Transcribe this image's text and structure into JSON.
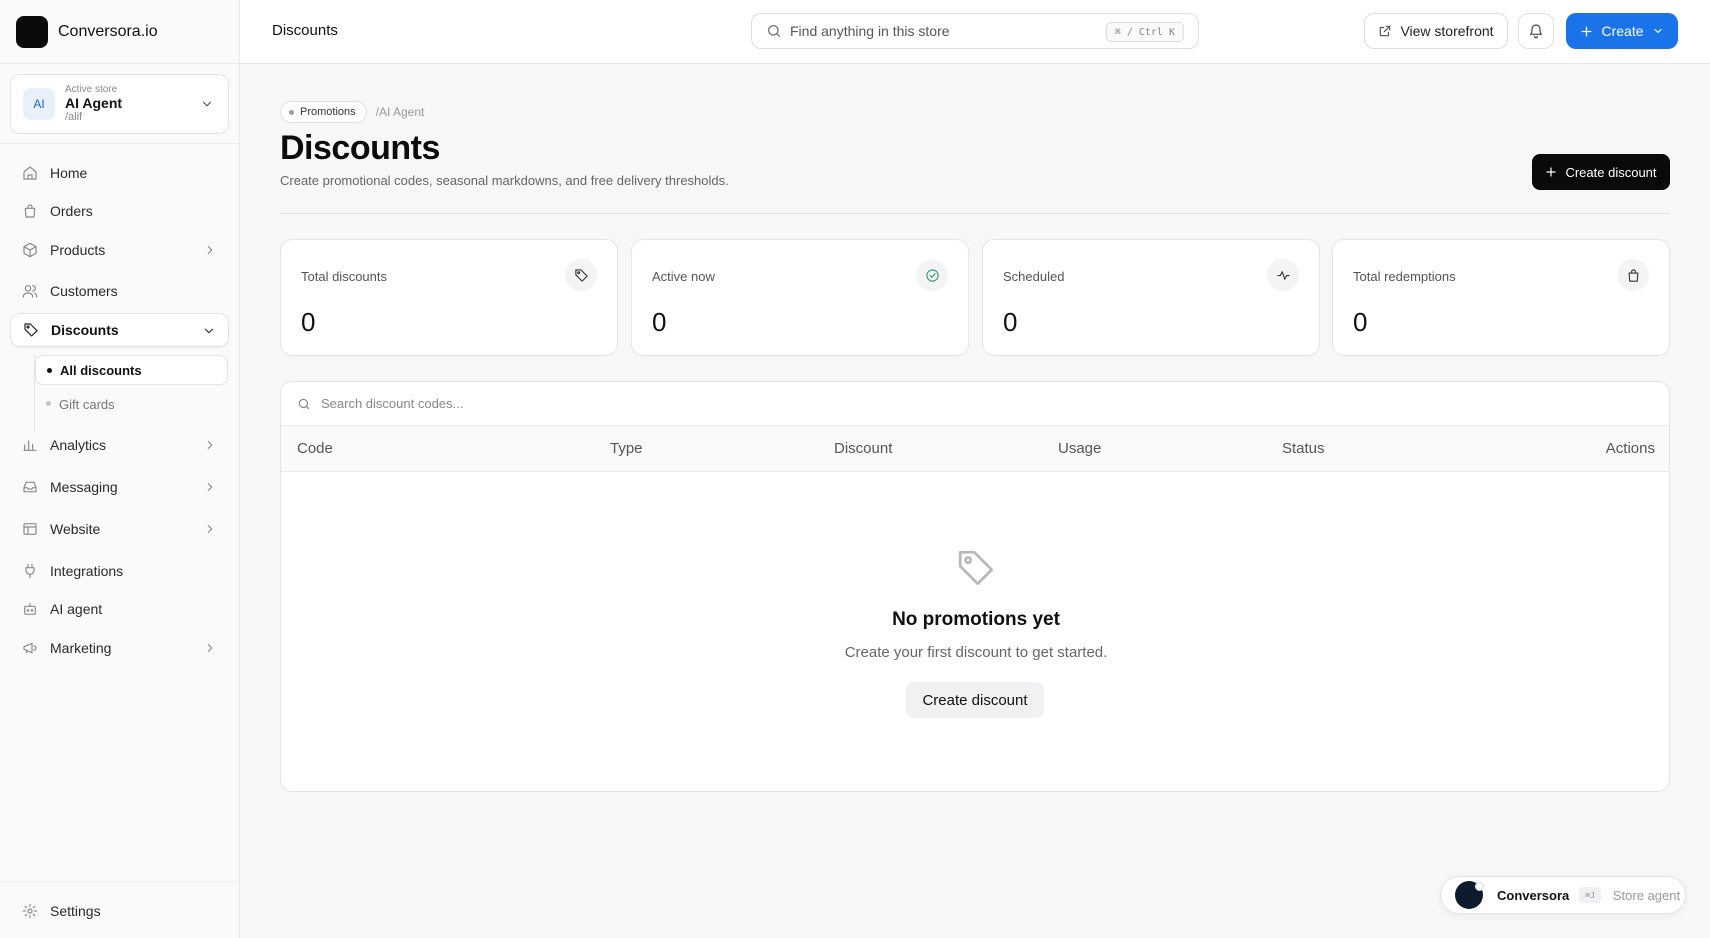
{
  "brand": {
    "name": "Conversora.io"
  },
  "store": {
    "kicker": "Active store",
    "avatar": "AI",
    "name": "AI Agent",
    "handle": "/alif"
  },
  "nav": {
    "home": "Home",
    "orders": "Orders",
    "products": "Products",
    "customers": "Customers",
    "discounts": "Discounts",
    "sub_all": "All discounts",
    "sub_gift": "Gift cards",
    "analytics": "Analytics",
    "messaging": "Messaging",
    "website": "Website",
    "integrations": "Integrations",
    "ai_agent": "AI agent",
    "marketing": "Marketing",
    "settings": "Settings"
  },
  "topbar": {
    "title": "Discounts",
    "search_placeholder": "Find anything in this store",
    "shortcut": "⌘ / Ctrl K",
    "storefront": "View storefront",
    "create": "Create"
  },
  "page": {
    "crumb": "Promotions",
    "crumb_rest": "/AI Agent",
    "title": "Discounts",
    "subtitle": "Create promotional codes, seasonal markdowns, and free delivery thresholds.",
    "create_button": "Create discount"
  },
  "stats": [
    {
      "label": "Total discounts",
      "value": "0",
      "icon": "tag-icon"
    },
    {
      "label": "Active now",
      "value": "0",
      "icon": "check-circle-icon"
    },
    {
      "label": "Scheduled",
      "value": "0",
      "icon": "activity-icon"
    },
    {
      "label": "Total redemptions",
      "value": "0",
      "icon": "shopping-bag-icon"
    }
  ],
  "table": {
    "search_placeholder": "Search discount codes...",
    "columns": [
      "Code",
      "Type",
      "Discount",
      "Usage",
      "Status",
      "Actions"
    ],
    "empty_title": "No promotions yet",
    "empty_sub": "Create your first discount to get started.",
    "empty_button": "Create discount"
  },
  "agent": {
    "name": "Conversora",
    "shortcut": "⌘J",
    "role": "Store agent"
  },
  "colors": {
    "accent": "#1a73e8",
    "dark": "#0a0a0a",
    "success": "#2e9e6a"
  }
}
